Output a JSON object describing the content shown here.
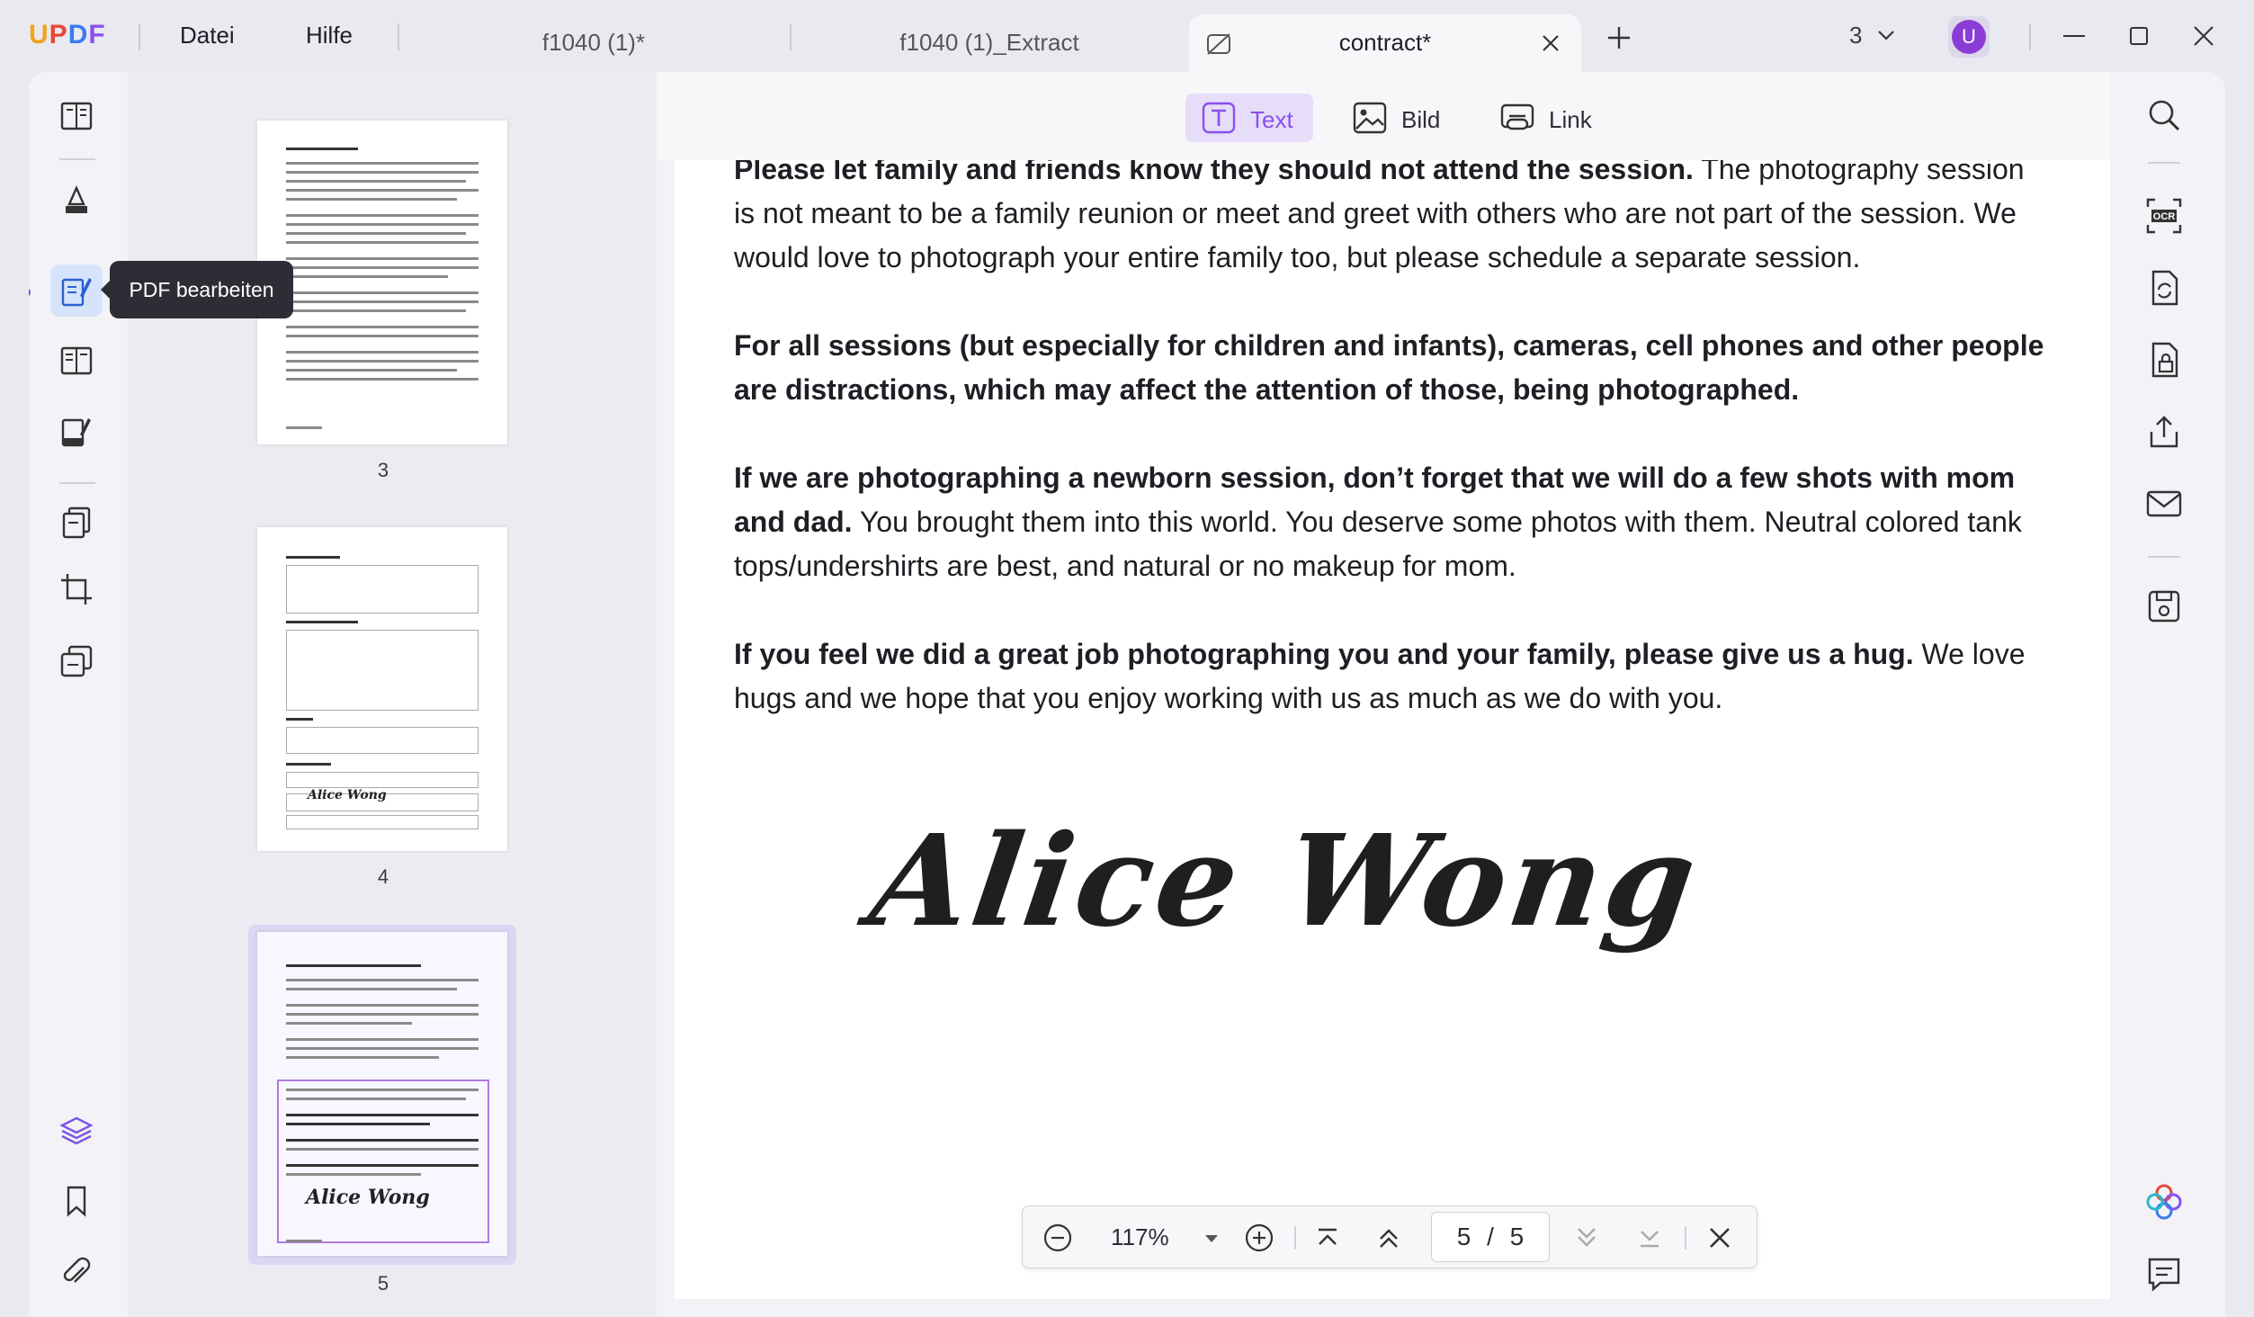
{
  "app": {
    "logo": "UPDF"
  },
  "menu": {
    "file": "Datei",
    "help": "Hilfe"
  },
  "tabs": [
    {
      "label": "f1040 (1)*"
    },
    {
      "label": "f1040 (1)_Extract"
    },
    {
      "label": "contract*"
    }
  ],
  "window": {
    "open_tabs_count": "3",
    "user_initial": "U"
  },
  "left_tools": {
    "tooltip": "PDF bearbeiten"
  },
  "thumbnails": [
    {
      "page": "3"
    },
    {
      "page": "4",
      "signature": "Alice Wong"
    },
    {
      "page": "5",
      "signature": "Alice Wong"
    }
  ],
  "edit_toolbar": {
    "text": "Text",
    "image": "Bild",
    "link": "Link"
  },
  "document": {
    "para1_bold": "Please let family and friends know they should not attend the session.",
    "para1_rest": " The photography session is not meant to be a family reunion or meet and greet with others who are not part of the session. We would love to photograph your entire family too, but please schedule a separate session.",
    "para2_bold": "For all sessions (but especially for children and infants), cameras, cell phones and other people are distractions, which may affect the attention of those, being photographed.",
    "para3_bold": "If we are photographing a newborn session, don’t forget that we will do a few shots with mom and dad.",
    "para3_rest": " You brought them into this world. You deserve some photos with them. Neutral colored tank tops/undershirts are best, and natural or no makeup for mom.",
    "para4_bold": "If you feel we did a great job photographing you and your family, please give us a hug.",
    "para4_rest": " We love hugs and we hope that you enjoy working with us as much as we do with you.",
    "signature": "Alice Wong"
  },
  "zoombar": {
    "zoom": "117%",
    "current_page": "5",
    "separator": "/",
    "total_pages": "5"
  },
  "colors": {
    "accent": "#8a4ff0",
    "tooltip_bg": "#2d2d35",
    "active_tool_bg": "#d6e4fb"
  }
}
